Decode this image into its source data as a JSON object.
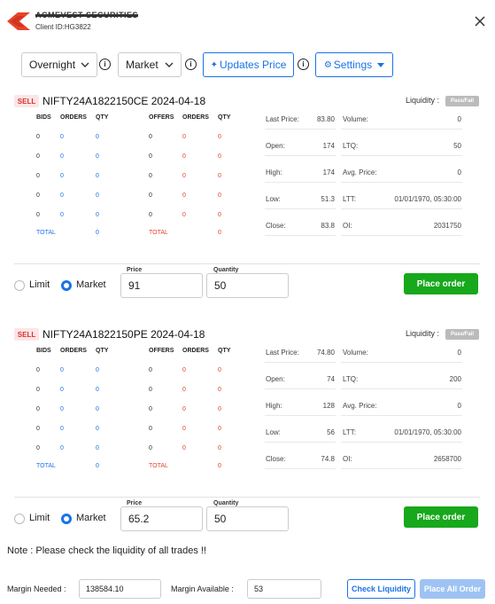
{
  "header": {
    "brand_name": "ACMEVEST SECURITIES",
    "client_id": "Client ID:HG3822",
    "brand_color": "#e8432a"
  },
  "toolbar": {
    "product_select": "Overnight",
    "order_type_select": "Market",
    "updates_price_label": "Updates Price",
    "settings_label": "Settings",
    "info_glyph": "i"
  },
  "depth_headers": {
    "bids": "BIDS",
    "orders": "ORDERS",
    "qty": "QTY",
    "offers": "OFFERS",
    "orders2": "ORDERS",
    "qty2": "QTY",
    "total": "TOTAL"
  },
  "stat_labels": {
    "last_price": "Last Price:",
    "volume": "Volume:",
    "open": "Open:",
    "ltq": "LTQ:",
    "high": "High:",
    "avg_price": "Avg. Price:",
    "low": "Low:",
    "ltt": "LTT:",
    "close": "Close:",
    "oi": "OI:"
  },
  "liquidity_label": "Liquidity :",
  "pass_fail_label": "Pass/Fail",
  "orders": [
    {
      "side": "SELL",
      "instrument": "NIFTY24A1822150CE 2024-04-18",
      "depth": {
        "bids": [
          {
            "bid": "0",
            "orders": "0",
            "qty": "0"
          },
          {
            "bid": "0",
            "orders": "0",
            "qty": "0"
          },
          {
            "bid": "0",
            "orders": "0",
            "qty": "0"
          },
          {
            "bid": "0",
            "orders": "0",
            "qty": "0"
          },
          {
            "bid": "0",
            "orders": "0",
            "qty": "0"
          }
        ],
        "offers": [
          {
            "offer": "0",
            "orders": "0",
            "qty": "0"
          },
          {
            "offer": "0",
            "orders": "0",
            "qty": "0"
          },
          {
            "offer": "0",
            "orders": "0",
            "qty": "0"
          },
          {
            "offer": "0",
            "orders": "0",
            "qty": "0"
          },
          {
            "offer": "0",
            "orders": "0",
            "qty": "0"
          }
        ],
        "total_bid_qty": "0",
        "total_offer_qty": "0"
      },
      "stats": {
        "last_price": "83.80",
        "volume": "0",
        "open": "174",
        "ltq": "50",
        "high": "174",
        "avg_price": "0",
        "low": "51.3",
        "ltt": "01/01/1970, 05:30:00",
        "close": "83.8",
        "oi": "2031750"
      },
      "order_form": {
        "limit_label": "Limit",
        "market_label": "Market",
        "selected": "market",
        "price_label": "Price",
        "price": "91",
        "quantity_label": "Quantity",
        "quantity": "50",
        "place_order_label": "Place order"
      }
    },
    {
      "side": "SELL",
      "instrument": "NIFTY24A1822150PE 2024-04-18",
      "depth": {
        "bids": [
          {
            "bid": "0",
            "orders": "0",
            "qty": "0"
          },
          {
            "bid": "0",
            "orders": "0",
            "qty": "0"
          },
          {
            "bid": "0",
            "orders": "0",
            "qty": "0"
          },
          {
            "bid": "0",
            "orders": "0",
            "qty": "0"
          },
          {
            "bid": "0",
            "orders": "0",
            "qty": "0"
          }
        ],
        "offers": [
          {
            "offer": "0",
            "orders": "0",
            "qty": "0"
          },
          {
            "offer": "0",
            "orders": "0",
            "qty": "0"
          },
          {
            "offer": "0",
            "orders": "0",
            "qty": "0"
          },
          {
            "offer": "0",
            "orders": "0",
            "qty": "0"
          },
          {
            "offer": "0",
            "orders": "0",
            "qty": "0"
          }
        ],
        "total_bid_qty": "0",
        "total_offer_qty": "0"
      },
      "stats": {
        "last_price": "74.80",
        "volume": "0",
        "open": "74",
        "ltq": "200",
        "high": "128",
        "avg_price": "0",
        "low": "56",
        "ltt": "01/01/1970, 05:30:00",
        "close": "74.8",
        "oi": "2658700"
      },
      "order_form": {
        "limit_label": "Limit",
        "market_label": "Market",
        "selected": "market",
        "price_label": "Price",
        "price": "65.2",
        "quantity_label": "Quantity",
        "quantity": "50",
        "place_order_label": "Place order"
      }
    }
  ],
  "note": "Note : Please check the liquidity of all trades !!",
  "footer": {
    "margin_needed_label": "Margin Needed :",
    "margin_needed": "138584.10",
    "margin_available_label": "Margin Available :",
    "margin_available": "53",
    "check_liquidity_label": "Check Liquidity",
    "place_all_label": "Place All Order"
  },
  "colors": {
    "primary": "#1a73e8",
    "success": "#17a81b",
    "sell": "#d63232",
    "offer_red": "#e0452b"
  }
}
